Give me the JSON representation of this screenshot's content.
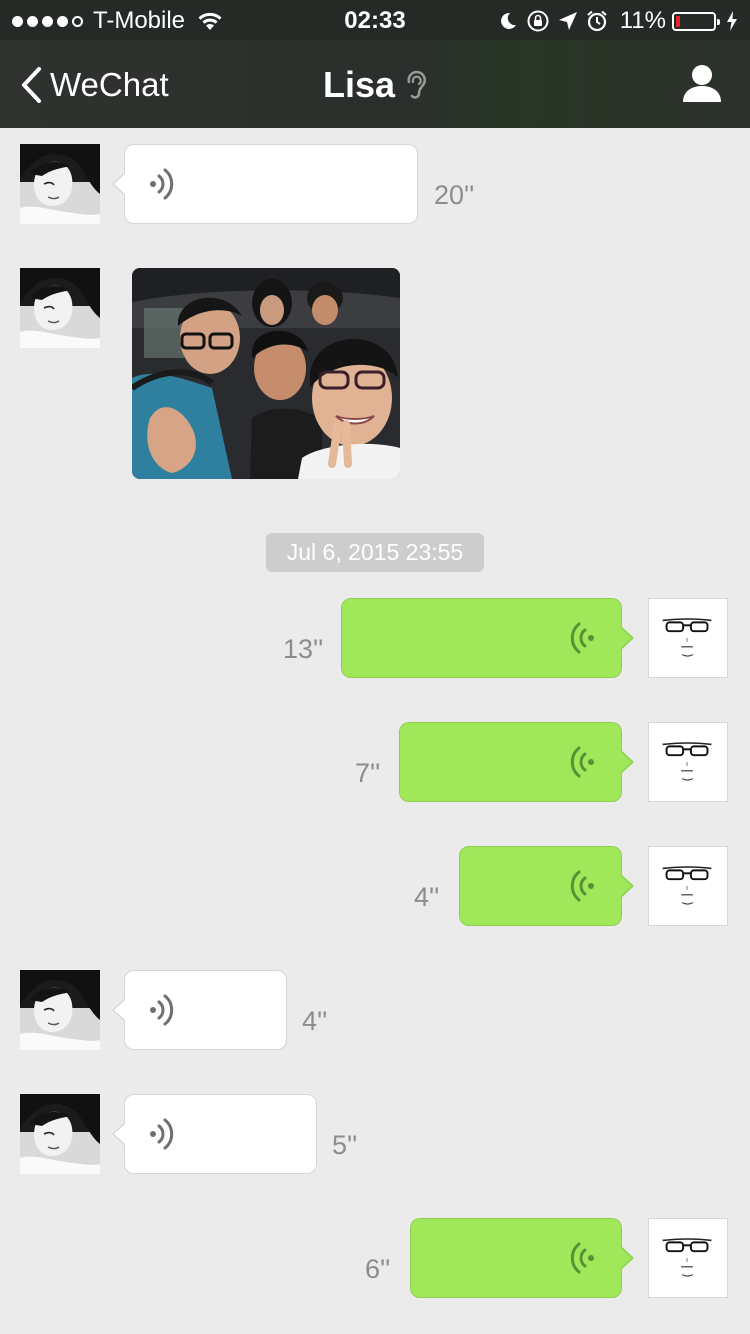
{
  "status_bar": {
    "carrier": "T-Mobile",
    "time": "02:33",
    "battery_percent": "11%",
    "battery_level": 0.11,
    "signal_bars": 4,
    "icons": [
      "wifi-icon",
      "moon-icon",
      "rotation-lock-icon",
      "location-arrow-icon",
      "alarm-icon",
      "battery-icon",
      "charging-bolt-icon"
    ]
  },
  "nav": {
    "back_label": "WeChat",
    "title": "Lisa",
    "title_icon": "ear-icon",
    "right_icon": "person-icon"
  },
  "colors": {
    "background": "#ebebeb",
    "nav_bar": "#2f322f",
    "outgoing_bubble": "#a0e75a",
    "incoming_bubble": "#ffffff",
    "battery_low": "#e8232b",
    "duration_text": "#8c8c8c"
  },
  "messages": [
    {
      "sender": "Lisa",
      "type": "voice",
      "duration": "20''"
    },
    {
      "sender": "Lisa",
      "type": "photo"
    },
    {
      "type": "timestamp",
      "text": "Jul 6, 2015 23:55"
    },
    {
      "sender": "me",
      "type": "voice",
      "duration": "13''"
    },
    {
      "sender": "me",
      "type": "voice",
      "duration": "7''"
    },
    {
      "sender": "me",
      "type": "voice",
      "duration": "4''"
    },
    {
      "sender": "Lisa",
      "type": "voice",
      "duration": "4''"
    },
    {
      "sender": "Lisa",
      "type": "voice",
      "duration": "5''"
    },
    {
      "sender": "me",
      "type": "voice",
      "duration": "6''"
    }
  ]
}
